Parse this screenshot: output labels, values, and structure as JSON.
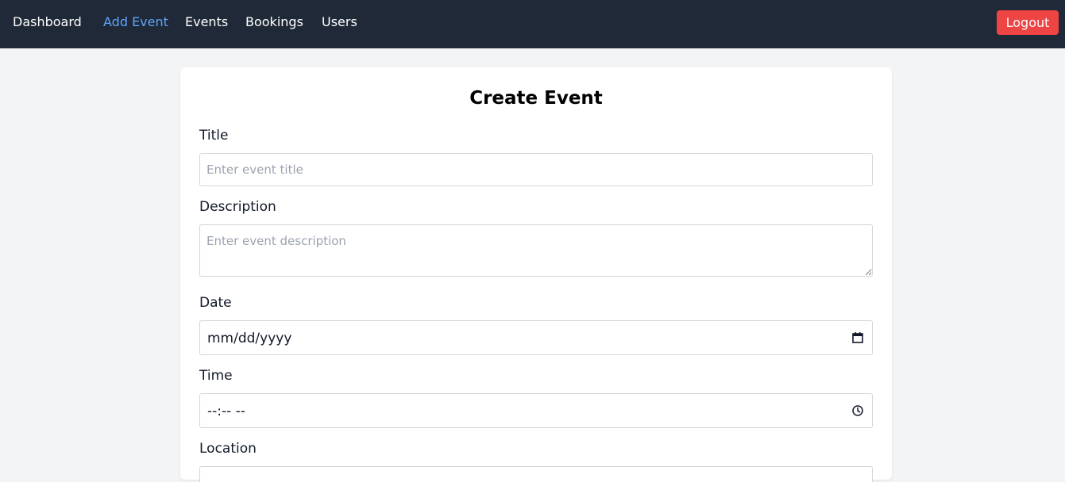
{
  "nav": {
    "links": [
      {
        "label": "Dashboard",
        "active": false
      },
      {
        "label": "Add Event",
        "active": true
      },
      {
        "label": "Events",
        "active": false
      },
      {
        "label": "Bookings",
        "active": false
      },
      {
        "label": "Users",
        "active": false
      }
    ],
    "logout_label": "Logout"
  },
  "form": {
    "title": "Create Event",
    "fields": {
      "title": {
        "label": "Title",
        "placeholder": "Enter event title",
        "value": ""
      },
      "description": {
        "label": "Description",
        "placeholder": "Enter event description",
        "value": ""
      },
      "date": {
        "label": "Date",
        "display": "mm/dd/yyyy",
        "icon": "calendar-icon"
      },
      "time": {
        "label": "Time",
        "display": "--:-- --",
        "icon": "clock-icon"
      },
      "location": {
        "label": "Location"
      }
    }
  },
  "colors": {
    "navbar_bg": "#1f2937",
    "active_link": "#60a5fa",
    "logout_bg": "#ef4444",
    "page_bg": "#f3f4f6"
  }
}
